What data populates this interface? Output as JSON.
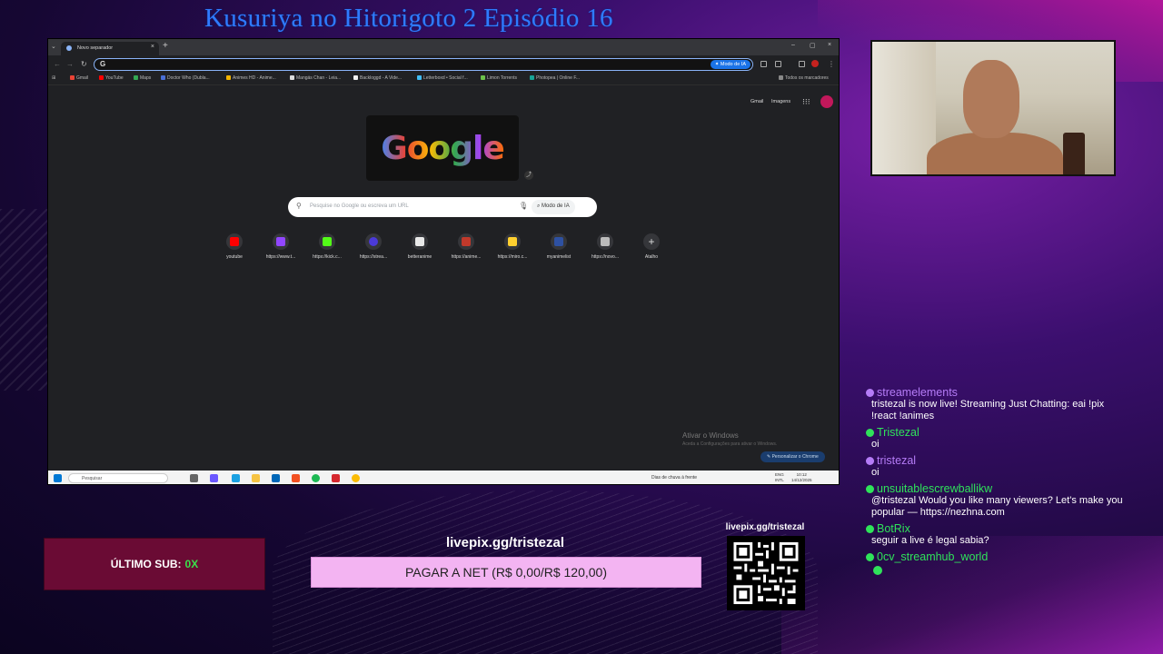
{
  "stream": {
    "title": "Kusuriya no Hitorigoto 2 Episódio 16"
  },
  "browser": {
    "tab_title": "Novo separador",
    "tab_close": "×",
    "new_tab": "+",
    "window_controls": [
      "–",
      "▢",
      "×"
    ],
    "omnibox_icon": "G",
    "ai_mode_label": "Modo de IA",
    "bookmarks": [
      {
        "label": "Gmail",
        "color": "#ea4335"
      },
      {
        "label": "YouTube",
        "color": "#ff0000"
      },
      {
        "label": "Maps",
        "color": "#34a853"
      },
      {
        "label": "Doctor Who (Dubla...",
        "color": "#4a6fd6"
      },
      {
        "label": "Animes HD - Anime...",
        "color": "#f4b400"
      },
      {
        "label": "Mangás Chan - Leia...",
        "color": "#dddddd"
      },
      {
        "label": "Backloggd - A Vide...",
        "color": "#f0f0f0"
      },
      {
        "label": "Letterboxd • Social f...",
        "color": "#40bcf4"
      },
      {
        "label": "Limon Torrents",
        "color": "#6cc24a"
      },
      {
        "label": "Photopea | Online F...",
        "color": "#18a497"
      }
    ],
    "all_bookmarks_label": "Todos os marcadores",
    "gmail_link": "Gmail",
    "images_link": "Imagens",
    "doodle_text": "Google",
    "search_placeholder": "Pesquise no Google ou escreva um URL",
    "search_mode_label": "Modo de IA",
    "shortcuts": [
      {
        "label": "youtube",
        "color": "#ff0000"
      },
      {
        "label": "https://www.t...",
        "color": "#9146ff"
      },
      {
        "label": "https://kick.c...",
        "color": "#53fc18"
      },
      {
        "label": "https://strea...",
        "color": "#4b3ad8"
      },
      {
        "label": "betteranime",
        "color": "#e8e8e8"
      },
      {
        "label": "https://anime...",
        "color": "#c0392b"
      },
      {
        "label": "https://miro.c...",
        "color": "#ffd02f"
      },
      {
        "label": "myanimelist",
        "color": "#2e51a2"
      },
      {
        "label": "https://novo...",
        "color": "#bbbbbb"
      },
      {
        "label": "Atalho",
        "color": ""
      }
    ],
    "activate_title": "Ativar o Windows",
    "activate_sub": "Aceda a Configurações para ativar o Windows.",
    "customize_label": "Personalizar o Chrome"
  },
  "taskbar": {
    "search_label": "Pesquisar",
    "weather": "Dias de chuva à frente",
    "lang": "ENG",
    "lang_region": "INTL",
    "time": "10:12",
    "date": "14/12/2025"
  },
  "chat": [
    {
      "user": "streamelements",
      "color": "#b57cf7",
      "badge": "#b57cf7",
      "text": "tristezal is now live! Streaming Just Chatting: eai !pix !react !animes"
    },
    {
      "user": "Tristezal",
      "color": "#2fe35a",
      "badge": "#2fe35a",
      "text": "oi"
    },
    {
      "user": "tristezal",
      "color": "#b57cf7",
      "badge": "#b57cf7",
      "text": "oi"
    },
    {
      "user": "unsuitablescrewballikw",
      "color": "#2fe35a",
      "badge": "#2fe35a",
      "text": "@tristezal Would you like many viewers? Let's make you popular — https://nezhna.com"
    },
    {
      "user": "BotRix",
      "color": "#2fe35a",
      "badge": "#2fe35a",
      "text": "seguir a live é legal sabia?"
    },
    {
      "user": "0cv_streamhub_world",
      "color": "#2fe35a",
      "badge": "#2fe35a",
      "text": ""
    }
  ],
  "overlay": {
    "sub_label": "ÚLTIMO SUB:",
    "sub_value": "0X",
    "livepix_title": "livepix.gg/tristezal",
    "pay_label": "PAGAR A NET (R$ 0,00/R$ 120,00)",
    "qr_label": "livepix.gg/tristezal"
  }
}
